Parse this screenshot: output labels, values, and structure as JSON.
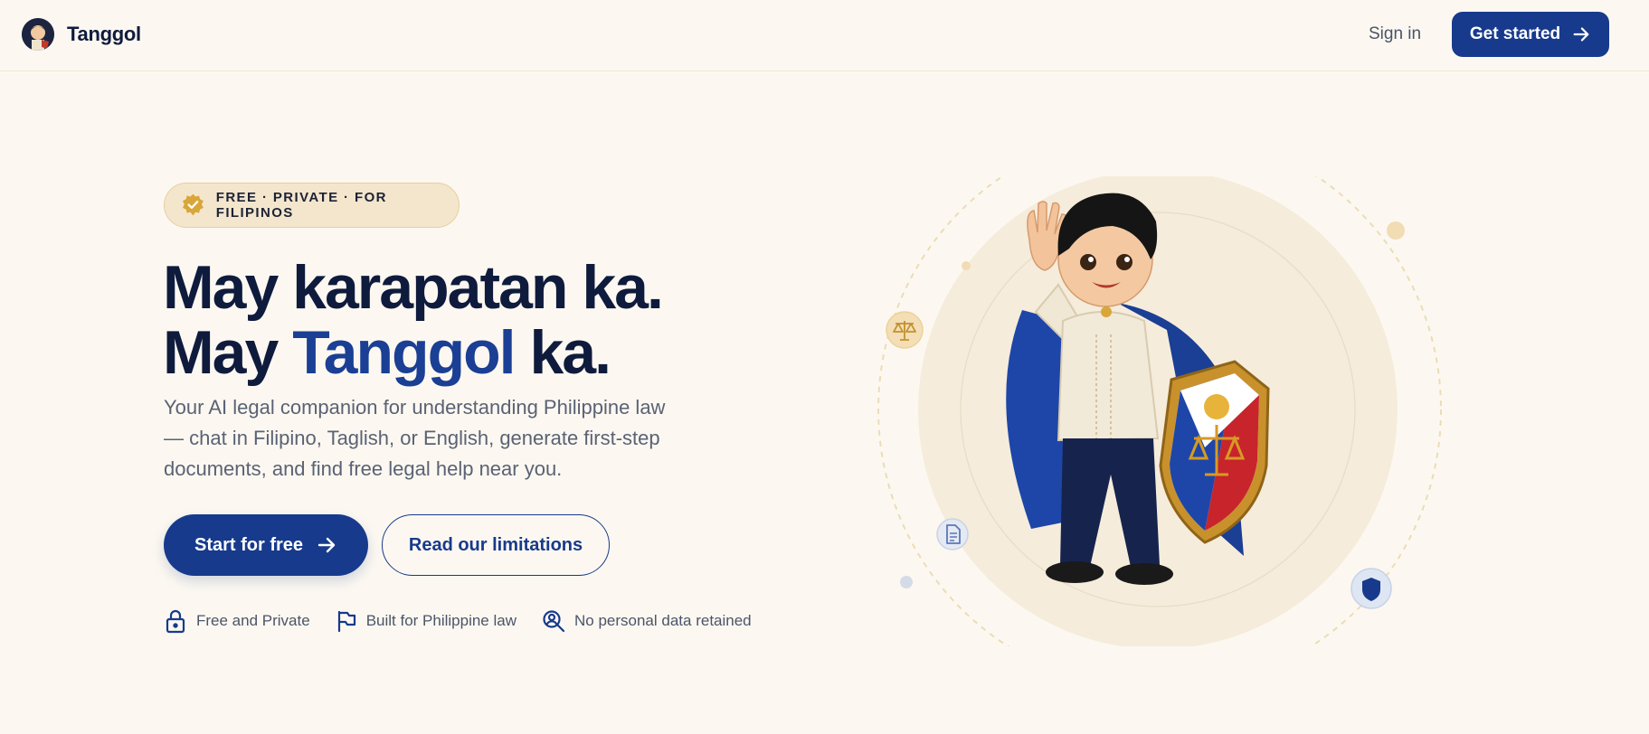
{
  "header": {
    "brand": "Tanggol",
    "signin_label": "Sign in",
    "cta_label": "Get started"
  },
  "hero": {
    "badge": "FREE · PRIVATE · FOR FILIPINOS",
    "headline_line1": "May karapatan ka.",
    "headline_line2_pre": "May ",
    "headline_line2_accent": "Tanggol",
    "headline_line2_post": " ka.",
    "subtitle": "Your AI legal companion for understanding Philippine law — chat in Filipino, Taglish, or English, generate first-step documents, and find free legal help near you.",
    "primary_button": "Start for free",
    "secondary_button": "Read our limitations",
    "features": [
      {
        "icon": "lock-icon",
        "label": "Free and Private"
      },
      {
        "icon": "flag-icon",
        "label": "Built for Philippine law"
      },
      {
        "icon": "user-search-icon",
        "label": "No personal data retained"
      }
    ]
  },
  "illustration": {
    "subject": "mascot-boy-with-shield",
    "orbit_icons": [
      "scales-icon",
      "document-icon",
      "shield-icon"
    ]
  },
  "colors": {
    "background": "#fcf8f1",
    "primary": "#173a8c",
    "accent": "#1a3f94",
    "gold": "#d9a63a",
    "text": "#0f1b3d"
  }
}
